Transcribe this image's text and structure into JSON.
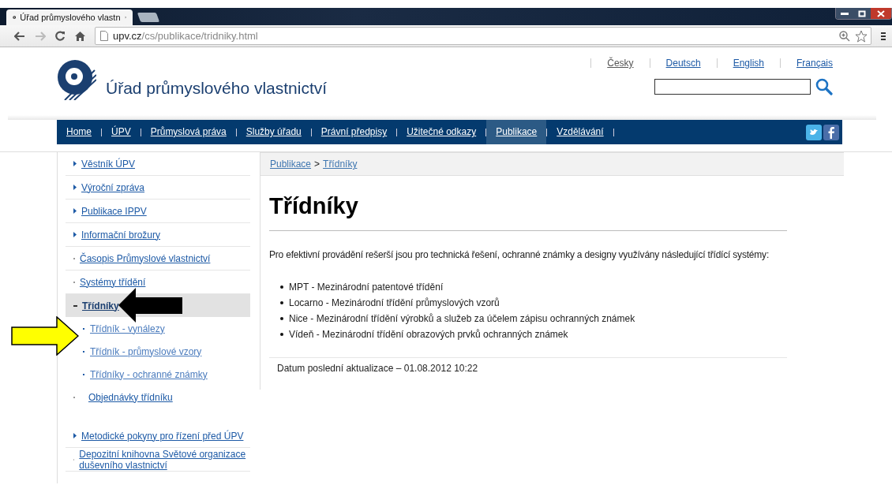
{
  "browser": {
    "tab_title": "Úřad průmyslového vlastn",
    "address_host": "upv.cz",
    "address_path": "/cs/publikace/tridniky.html"
  },
  "header": {
    "site_title": "Úřad průmyslového vlastnictví",
    "languages": [
      {
        "label": "Česky",
        "selected": true
      },
      {
        "label": "Deutsch",
        "selected": false
      },
      {
        "label": "English",
        "selected": false
      },
      {
        "label": "Français",
        "selected": false
      }
    ]
  },
  "nav": [
    {
      "label": "Home",
      "selected": false
    },
    {
      "label": "ÚPV",
      "selected": false
    },
    {
      "label": "Průmyslová práva",
      "selected": false
    },
    {
      "label": "Služby úřadu",
      "selected": false
    },
    {
      "label": "Právní předpisy",
      "selected": false
    },
    {
      "label": "Užitečné odkazy",
      "selected": false
    },
    {
      "label": "Publikace",
      "selected": true
    },
    {
      "label": "Vzdělávání",
      "selected": false
    }
  ],
  "sidebar": [
    {
      "label": "Věstník ÚPV",
      "kind": "arrow",
      "selected": false
    },
    {
      "label": "Výroční zpráva",
      "kind": "arrow",
      "selected": false
    },
    {
      "label": "Publikace IPPV",
      "kind": "arrow",
      "selected": false
    },
    {
      "label": "Informační brožury",
      "kind": "arrow",
      "selected": false
    },
    {
      "label": "Časopis Průmyslové vlastnictví",
      "kind": "dot",
      "selected": false
    },
    {
      "label": "Systémy třídění",
      "kind": "dot",
      "selected": false
    },
    {
      "label": "Třídníky",
      "kind": "open",
      "selected": true,
      "children": [
        {
          "label": "Třídník - vynálezy"
        },
        {
          "label": "Třídník - průmyslové vzory"
        },
        {
          "label": "Třídníky - ochranné známky"
        }
      ]
    },
    {
      "label": "Objednávky třídníku",
      "kind": "wide-dot",
      "selected": false
    },
    {
      "label": "Metodické pokyny pro řízení před ÚPV",
      "kind": "arrow",
      "selected": false
    },
    {
      "label": "Depozitní knihovna Světové organizace duševního vlastnictví",
      "kind": "dot",
      "selected": false
    }
  ],
  "breadcrumbs": [
    "Publikace",
    "Třídníky"
  ],
  "breadcrumb_separator": ">",
  "heading": "Třídníky",
  "intro": "Pro efektivní provádění rešerší jsou pro technická řešení, ochranné známky a designy využívány následující třídící systémy:",
  "systems": [
    "MPT - Mezinárodní patentové třídění",
    "Locarno - Mezinárodní třídění průmyslových vzorů",
    "Nice - Mezinárodní třídění výrobků a služeb za účelem zápisu ochranných známek",
    "Vídeň - Mezinárodní třídění obrazových prvků ochranných známek"
  ],
  "last_updated": "Datum poslední aktualizace – 01.08.2012 10:22"
}
